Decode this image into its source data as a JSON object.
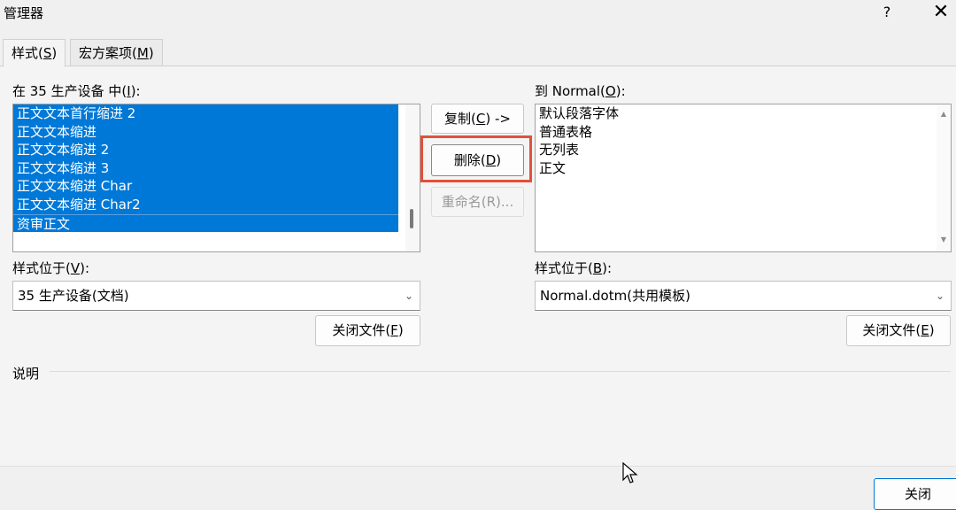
{
  "window": {
    "title": "管理器",
    "help_label": "?",
    "close_label": "✕"
  },
  "tabs": [
    {
      "label": "样式(",
      "key": "S",
      "suffix": ")"
    },
    {
      "label": "宏方案项(",
      "key": "M",
      "suffix": ")"
    }
  ],
  "left": {
    "label": "在 35 生产设备 中(",
    "key": "I",
    "suffix": "):",
    "items": [
      "正文文本首行缩进 2",
      "正文文本缩进",
      "正文文本缩进 2",
      "正文文本缩进 3",
      "正文文本缩进 Char",
      "正文文本缩进 Char2",
      "资审正文"
    ],
    "location_label": "样式位于(",
    "location_key": "V",
    "location_suffix": "):",
    "location_value": "35 生产设备(文档)",
    "close_file_label": "关闭文件(",
    "close_file_key": "F",
    "close_file_suffix": ")"
  },
  "right": {
    "label": "到 Normal(",
    "key": "O",
    "suffix": "):",
    "items": [
      "默认段落字体",
      "普通表格",
      "无列表",
      "正文"
    ],
    "location_label": "样式位于(",
    "location_key": "B",
    "location_suffix": "):",
    "location_value": "Normal.dotm(共用模板)",
    "close_file_label": "关闭文件(",
    "close_file_key": "E",
    "close_file_suffix": ")"
  },
  "actions": {
    "copy_label": "复制(",
    "copy_key": "C",
    "copy_suffix": ") ->",
    "delete_label": "删除(",
    "delete_key": "D",
    "delete_suffix": ")",
    "rename_label": "重命名(R)..."
  },
  "description": {
    "label": "说明"
  },
  "footer": {
    "close_label": "关闭"
  },
  "colors": {
    "selection": "#0078d7",
    "highlight_box": "#e2503a"
  }
}
